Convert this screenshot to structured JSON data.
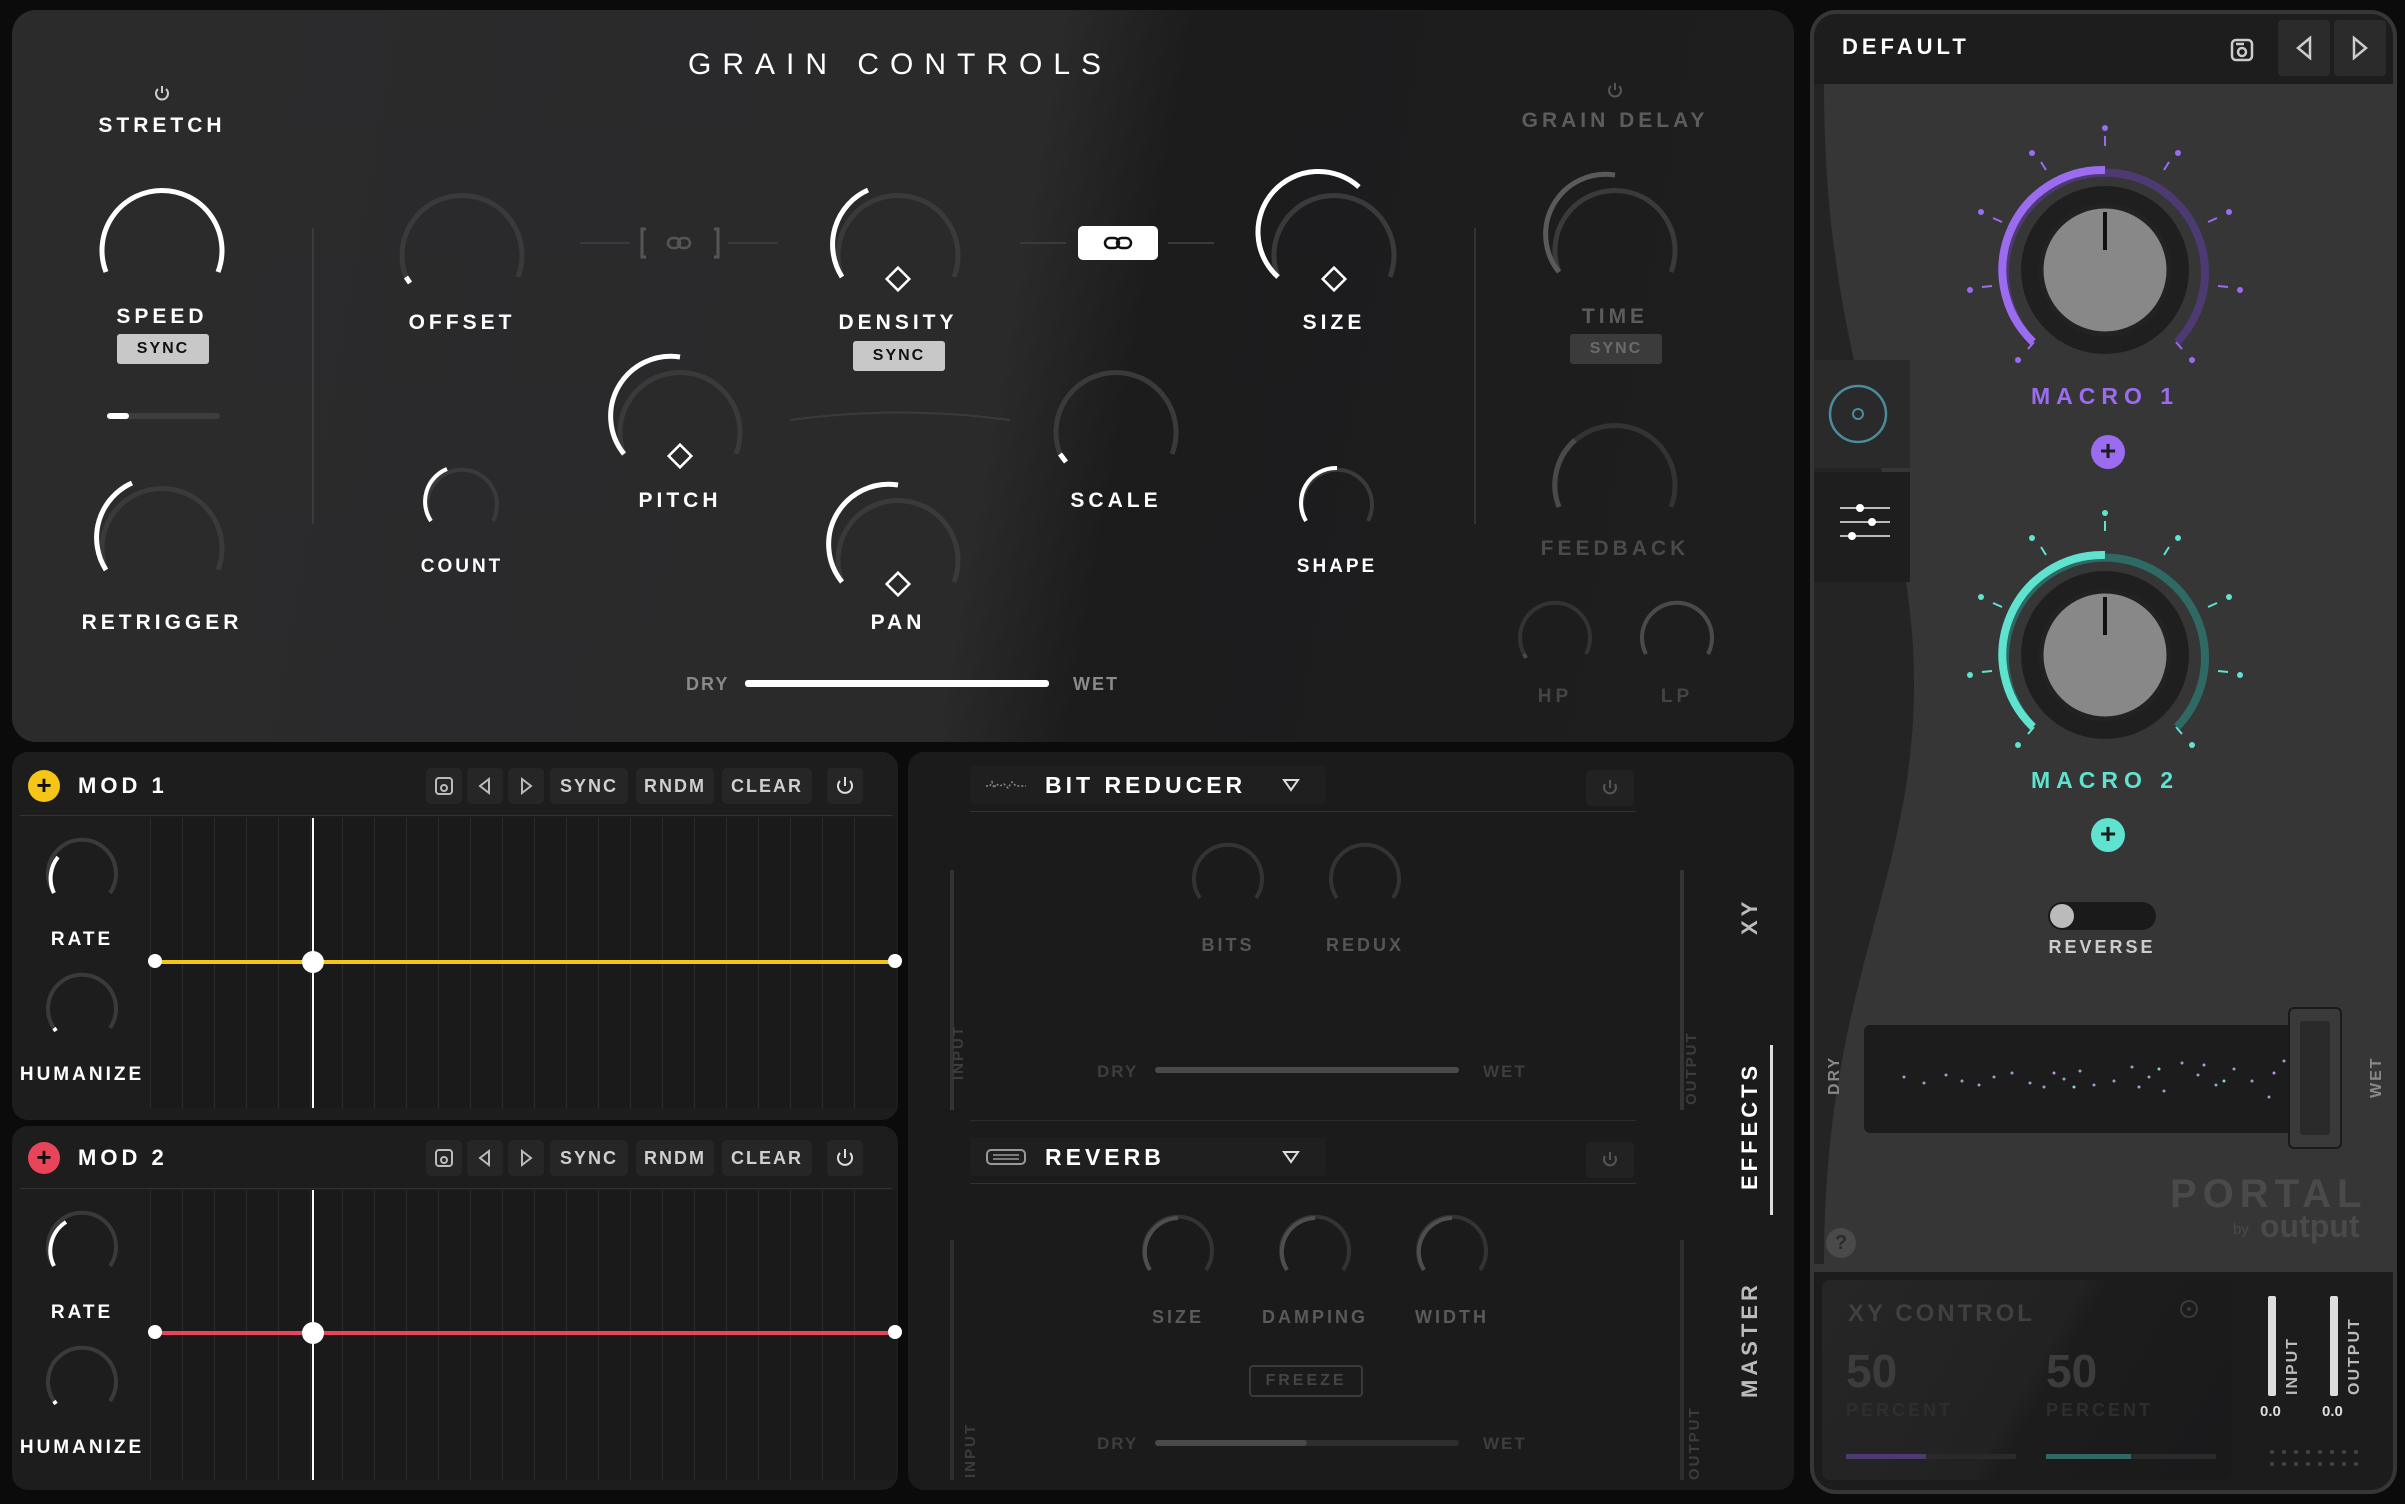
{
  "grain": {
    "title": "GRAIN CONTROLS",
    "stretch": "STRETCH",
    "speed": "SPEED",
    "speed_sync": "SYNC",
    "retrigger": "RETRIGGER",
    "offset": "OFFSET",
    "count": "COUNT",
    "pitch": "PITCH",
    "density": "DENSITY",
    "density_sync": "SYNC",
    "pan": "PAN",
    "scale": "SCALE",
    "size": "SIZE",
    "shape": "SHAPE",
    "dry": "DRY",
    "wet": "WET",
    "dry_wet_level": 1.0
  },
  "grain_delay": {
    "title": "GRAIN DELAY",
    "time": "TIME",
    "time_sync": "SYNC",
    "feedback": "FEEDBACK",
    "hp": "HP",
    "lp": "LP"
  },
  "mod1": {
    "title": "MOD 1",
    "sync": "SYNC",
    "rndm": "RNDM",
    "clear": "CLEAR",
    "rate": "RATE",
    "humanize": "HUMANIZE",
    "color": "#f5c518"
  },
  "mod2": {
    "title": "MOD 2",
    "sync": "SYNC",
    "rndm": "RNDM",
    "clear": "CLEAR",
    "rate": "RATE",
    "humanize": "HUMANIZE",
    "color": "#e8455a"
  },
  "fx1": {
    "name": "BIT REDUCER",
    "bits": "BITS",
    "redux": "REDUX",
    "dry": "DRY",
    "wet": "WET",
    "input": "INPUT",
    "output": "OUTPUT",
    "dry_wet_level": 1.0
  },
  "fx2": {
    "name": "REVERB",
    "size": "SIZE",
    "damping": "DAMPING",
    "width": "WIDTH",
    "freeze": "FREEZE",
    "dry": "DRY",
    "wet": "WET",
    "input": "INPUT",
    "output": "OUTPUT",
    "dry_wet_level": 0.5
  },
  "tabs": {
    "xy": "XY",
    "effects": "EFFECTS",
    "master": "MASTER"
  },
  "side": {
    "preset": "DEFAULT",
    "macro1": "MACRO 1",
    "macro2": "MACRO 2",
    "reverse": "REVERSE",
    "dry": "DRY",
    "wet": "WET",
    "brand": "PORTAL",
    "by": "by",
    "vendor": "output",
    "macro1_color": "#9b6cf0",
    "macro2_color": "#5fe3cf"
  },
  "xy": {
    "title": "XY CONTROL",
    "x_value": "50",
    "y_value": "50",
    "x_unit": "PERCENT",
    "y_unit": "PERCENT",
    "input": "INPUT",
    "output": "OUTPUT",
    "input_value": "0.0",
    "output_value": "0.0"
  }
}
